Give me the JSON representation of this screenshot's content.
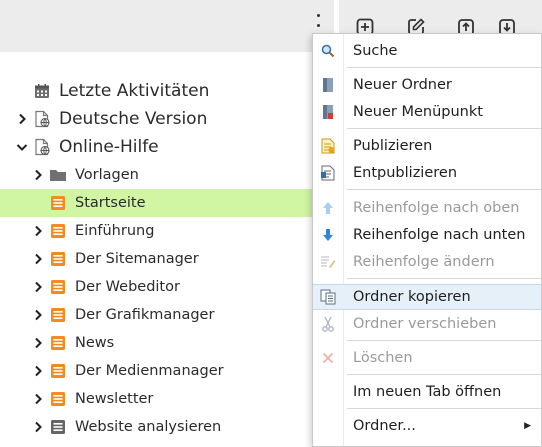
{
  "colors": {
    "toolbar_bg": "#ececec",
    "selected_row": "#d0f5a3",
    "folder_grey": "#707070",
    "page_orange": "#f28c1e",
    "menu_hover": "#e6f0f8"
  },
  "toolbar": {
    "kebab_icon": "kebab-vertical-icon",
    "buttons": [
      {
        "icon": "add-square-icon"
      },
      {
        "icon": "edit-square-icon"
      },
      {
        "icon": "upload-icon"
      },
      {
        "icon": "download-icon"
      }
    ]
  },
  "tree": {
    "items": [
      {
        "label": "Letzte Aktivitäten",
        "icon": "calendar-icon",
        "expanded": null
      },
      {
        "label": "Deutsche Version",
        "icon": "web-page-icon",
        "expanded": false
      },
      {
        "label": "Online-Hilfe",
        "icon": "web-page-icon",
        "expanded": true
      },
      {
        "label": "Vorlagen",
        "icon": "folder-icon",
        "expanded": false
      },
      {
        "label": "Startseite",
        "icon": "page-icon",
        "expanded": null,
        "selected": true
      },
      {
        "label": "Einführung",
        "icon": "page-icon",
        "expanded": false
      },
      {
        "label": "Der Sitemanager",
        "icon": "page-icon",
        "expanded": false
      },
      {
        "label": "Der Webeditor",
        "icon": "page-icon",
        "expanded": false
      },
      {
        "label": "Der Grafikmanager",
        "icon": "page-icon",
        "expanded": false
      },
      {
        "label": "News",
        "icon": "page-icon",
        "expanded": false
      },
      {
        "label": "Der Medienmanager",
        "icon": "page-icon",
        "expanded": false
      },
      {
        "label": "Newsletter",
        "icon": "page-icon",
        "expanded": false
      },
      {
        "label": "Website analysieren",
        "icon": "table-icon",
        "expanded": false
      }
    ]
  },
  "context_menu": {
    "items": [
      {
        "label": "Suche",
        "icon": "search-icon",
        "enabled": true
      },
      {
        "label": "Neuer Ordner",
        "icon": "new-folder-icon",
        "enabled": true
      },
      {
        "label": "Neuer Menüpunkt",
        "icon": "new-menu-item-icon",
        "enabled": true
      },
      {
        "label": "Publizieren",
        "icon": "publish-icon",
        "enabled": true
      },
      {
        "label": "Entpublizieren",
        "icon": "unpublish-icon",
        "enabled": true
      },
      {
        "label": "Reihenfolge nach oben",
        "icon": "arrow-up-icon",
        "enabled": false
      },
      {
        "label": "Reihenfolge nach unten",
        "icon": "arrow-down-icon",
        "enabled": true
      },
      {
        "label": "Reihenfolge ändern",
        "icon": "reorder-icon",
        "enabled": false
      },
      {
        "label": "Ordner kopieren",
        "icon": "copy-icon",
        "enabled": true,
        "hover": true
      },
      {
        "label": "Ordner verschieben",
        "icon": "cut-icon",
        "enabled": false
      },
      {
        "label": "Löschen",
        "icon": "delete-icon",
        "enabled": false
      },
      {
        "label": "Im neuen Tab öffnen",
        "icon": "",
        "enabled": true
      },
      {
        "label": "Ordner...",
        "icon": "",
        "enabled": true,
        "submenu": true
      }
    ]
  }
}
